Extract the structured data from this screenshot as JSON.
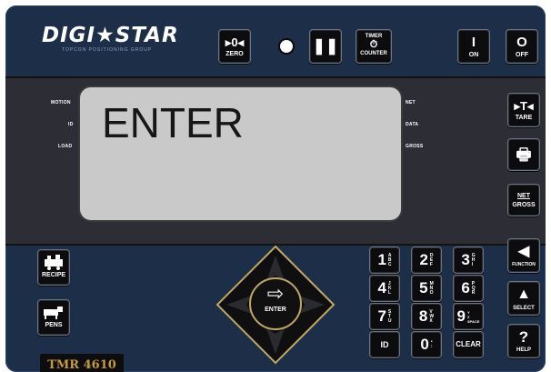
{
  "brand": {
    "logo": "DIGI★STAR",
    "tagline": "TOPCON POSITIONING GROUP"
  },
  "top_keys": {
    "zero": {
      "symbol": "▸0◂",
      "label": "ZERO"
    },
    "hold": {
      "symbol": "❚❚"
    },
    "timer": {
      "top": "TIMER",
      "symbol": "⏱",
      "label": "COUNTER"
    },
    "on": {
      "symbol": "I",
      "label": "ON"
    },
    "off": {
      "symbol": "O",
      "label": "OFF"
    }
  },
  "indicators": {
    "left": [
      "MOTION",
      "ID",
      "LOAD"
    ],
    "right": [
      "NET",
      "DATA",
      "GROSS"
    ]
  },
  "display": {
    "text": "ENTER"
  },
  "right_keys": {
    "tare": {
      "symbol": "▸T◂",
      "label": "TARE"
    },
    "print": {
      "symbol": "🖶"
    },
    "netgross": {
      "top": "NET",
      "label": "GROSS"
    },
    "function": {
      "symbol": "◀",
      "label": "FUNCTION"
    },
    "select": {
      "symbol": "▲",
      "label": "SELECT"
    },
    "help": {
      "symbol": "?",
      "label": "HELP"
    }
  },
  "left_keys": {
    "recipe": {
      "label": "RECIPE"
    },
    "pens": {
      "label": "PENS"
    }
  },
  "enter": {
    "symbol": "⇨",
    "label": "ENTER"
  },
  "keypad": {
    "k1": {
      "digit": "1",
      "sub": "A\nB\nC"
    },
    "k2": {
      "digit": "2",
      "sub": "D\nE\nF"
    },
    "k3": {
      "digit": "3",
      "sub": "G\nH\nI"
    },
    "k4": {
      "digit": "4",
      "sub": "J\nK\nL"
    },
    "k5": {
      "digit": "5",
      "sub": "M\nN\nO"
    },
    "k6": {
      "digit": "6",
      "sub": "P\nQ\nR"
    },
    "k7": {
      "digit": "7",
      "sub": "S\nT\nU"
    },
    "k8": {
      "digit": "8",
      "sub": "V\nW\nX"
    },
    "k9": {
      "digit": "9",
      "sub": "Y\nZ\nSPACE"
    },
    "id": {
      "label": "ID"
    },
    "k0": {
      "digit": "0",
      "sub": "•\n:"
    },
    "clear": {
      "label": "CLEAR"
    }
  },
  "model": "TMR 4610",
  "colors": {
    "panel": "#1d2e49",
    "band": "#2d2d35",
    "lcd": "#c9c9c9",
    "accent": "#c2a85e",
    "model_text": "#c89a3b"
  }
}
